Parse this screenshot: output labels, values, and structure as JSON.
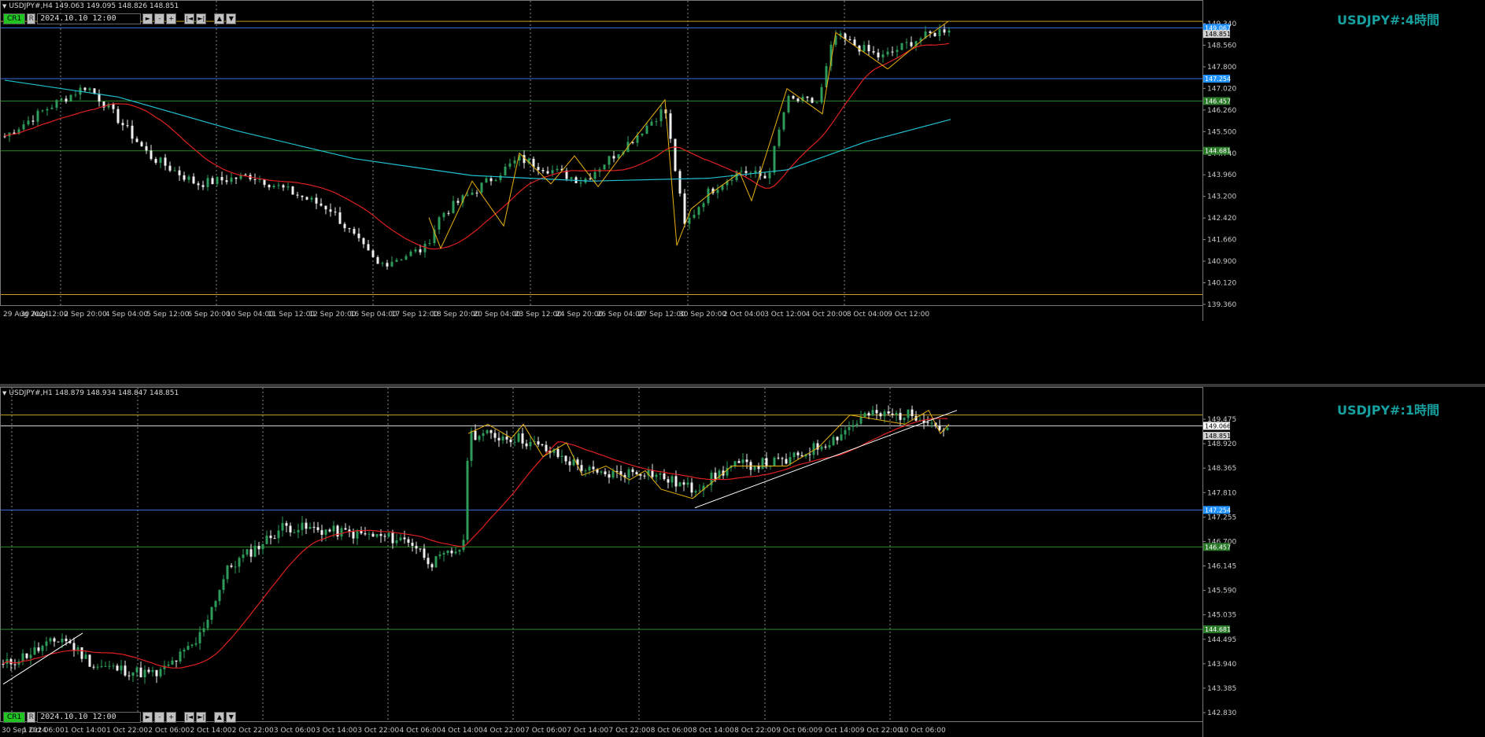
{
  "colors": {
    "accent": "#16a0a0",
    "bull": "#2e9b5a",
    "bear": "#f0f0f0",
    "sma_red": "#e02020",
    "sma_cyan": "#20c0d0",
    "zigzag": "#e8b010",
    "grid": "#8a8a8a"
  },
  "top": {
    "header": "USDJPY#,H4  149.063 149.095 148.826 148.851",
    "big_label": "USDJPY#:4時間",
    "controls": {
      "cr": "CR1",
      "r": "R",
      "date": "2024.10.10 12:00",
      "play": "►",
      "minus": "-",
      "plus": "+",
      "first": "|◄",
      "last": "►|",
      "up": "▲",
      "down": "▼"
    },
    "price_labels": [
      "149.340",
      "148.560",
      "147.800",
      "147.020",
      "146.260",
      "145.500",
      "144.740",
      "143.960",
      "143.200",
      "142.420",
      "141.660",
      "140.900",
      "140.120",
      "139.360"
    ],
    "marker_labels": [
      {
        "text": "149.067",
        "color": "#1e90ff",
        "price": 149.067
      },
      {
        "text": "148.851",
        "color": "#d0d0d0",
        "price": 148.851
      },
      {
        "text": "147.254",
        "color": "#1e90ff",
        "price": 147.254
      },
      {
        "text": "146.457",
        "color": "#2a7a2a",
        "price": 146.457
      },
      {
        "text": "144.681",
        "color": "#2a7a2a",
        "price": 144.681
      }
    ],
    "hlines": [
      {
        "price": 149.3,
        "color": "#c8a020"
      },
      {
        "price": 149.067,
        "color": "#3a70e0"
      },
      {
        "price": 147.254,
        "color": "#3a70e0"
      },
      {
        "price": 146.457,
        "color": "#2a8a2a"
      },
      {
        "price": 144.681,
        "color": "#2a8a2a"
      },
      {
        "price": 139.55,
        "color": "#c8a020"
      }
    ],
    "time_labels": [
      "29 Aug 2024",
      "30 Aug 12:00",
      "2 Sep 20:00",
      "4 Sep 04:00",
      "5 Sep 12:00",
      "6 Sep 20:00",
      "10 Sep 04:00",
      "11 Sep 12:00",
      "12 Sep 20:00",
      "16 Sep 04:00",
      "17 Sep 12:00",
      "18 Sep 20:00",
      "20 Sep 04:00",
      "23 Sep 12:00",
      "24 Sep 20:00",
      "26 Sep 04:00",
      "27 Sep 12:00",
      "30 Sep 20:00",
      "2 Oct 04:00",
      "3 Oct 12:00",
      "4 Oct 20:00",
      "8 Oct 04:00",
      "9 Oct 12:00"
    ]
  },
  "bottom": {
    "header": "USDJPY#,H1  148.879 148.934 148.847 148.851",
    "big_label": "USDJPY#:1時間",
    "controls": {
      "cr": "CR1",
      "r": "R",
      "date": "2024.10.10 12:00",
      "play": "►",
      "minus": "-",
      "plus": "+",
      "first": "|◄",
      "last": "►|",
      "up": "▲",
      "down": "▼"
    },
    "price_labels": [
      "149.475",
      "148.920",
      "148.365",
      "147.810",
      "147.255",
      "146.700",
      "146.145",
      "145.590",
      "145.035",
      "144.495",
      "143.940",
      "143.385",
      "142.830"
    ],
    "marker_labels": [
      {
        "text": "149.066",
        "color": "#ffffff",
        "price": 149.066
      },
      {
        "text": "148.851",
        "color": "#d0d0d0",
        "price": 148.851
      },
      {
        "text": "147.254",
        "color": "#1e90ff",
        "price": 147.254
      },
      {
        "text": "146.457",
        "color": "#2a7a2a",
        "price": 146.457
      },
      {
        "text": "144.681",
        "color": "#2a7a2a",
        "price": 144.681
      }
    ],
    "hlines": [
      {
        "price": 149.3,
        "color": "#c8a020"
      },
      {
        "price": 149.066,
        "color": "#e0e0e0"
      },
      {
        "price": 147.254,
        "color": "#3a70e0"
      },
      {
        "price": 146.457,
        "color": "#2a8a2a"
      },
      {
        "price": 144.681,
        "color": "#2a8a2a"
      }
    ],
    "time_labels": [
      "30 Sep 2024",
      "1 Oct 06:00",
      "1 Oct 14:00",
      "1 Oct 22:00",
      "2 Oct 06:00",
      "2 Oct 14:00",
      "2 Oct 22:00",
      "3 Oct 06:00",
      "3 Oct 14:00",
      "3 Oct 22:00",
      "4 Oct 06:00",
      "4 Oct 14:00",
      "4 Oct 22:00",
      "7 Oct 06:00",
      "7 Oct 14:00",
      "7 Oct 22:00",
      "8 Oct 06:00",
      "8 Oct 14:00",
      "8 Oct 22:00",
      "9 Oct 06:00",
      "9 Oct 14:00",
      "9 Oct 22:00",
      "10 Oct 06:00"
    ]
  }
}
